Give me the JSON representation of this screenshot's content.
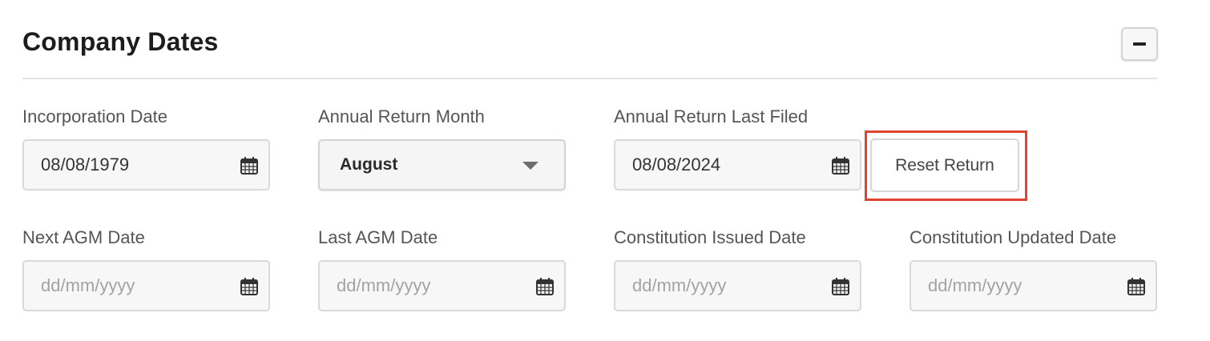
{
  "section": {
    "title": "Company Dates",
    "collapse_icon": "minus-icon"
  },
  "fields": {
    "incorporation": {
      "label": "Incorporation Date",
      "value": "08/08/1979",
      "placeholder": "dd/mm/yyyy"
    },
    "annual_return_month": {
      "label": "Annual Return Month",
      "value": "August"
    },
    "annual_return_last_filed": {
      "label": "Annual Return Last Filed",
      "value": "08/08/2024",
      "placeholder": "dd/mm/yyyy"
    },
    "next_agm": {
      "label": "Next AGM Date",
      "value": "",
      "placeholder": "dd/mm/yyyy"
    },
    "last_agm": {
      "label": "Last AGM Date",
      "value": "",
      "placeholder": "dd/mm/yyyy"
    },
    "constitution_issued": {
      "label": "Constitution Issued Date",
      "value": "",
      "placeholder": "dd/mm/yyyy"
    },
    "constitution_updated": {
      "label": "Constitution Updated Date",
      "value": "",
      "placeholder": "dd/mm/yyyy"
    }
  },
  "actions": {
    "reset_return_label": "Reset Return"
  },
  "colors": {
    "highlight": "#e0442c",
    "field_bg": "#f7f7f7",
    "border": "#d9d9d9"
  }
}
